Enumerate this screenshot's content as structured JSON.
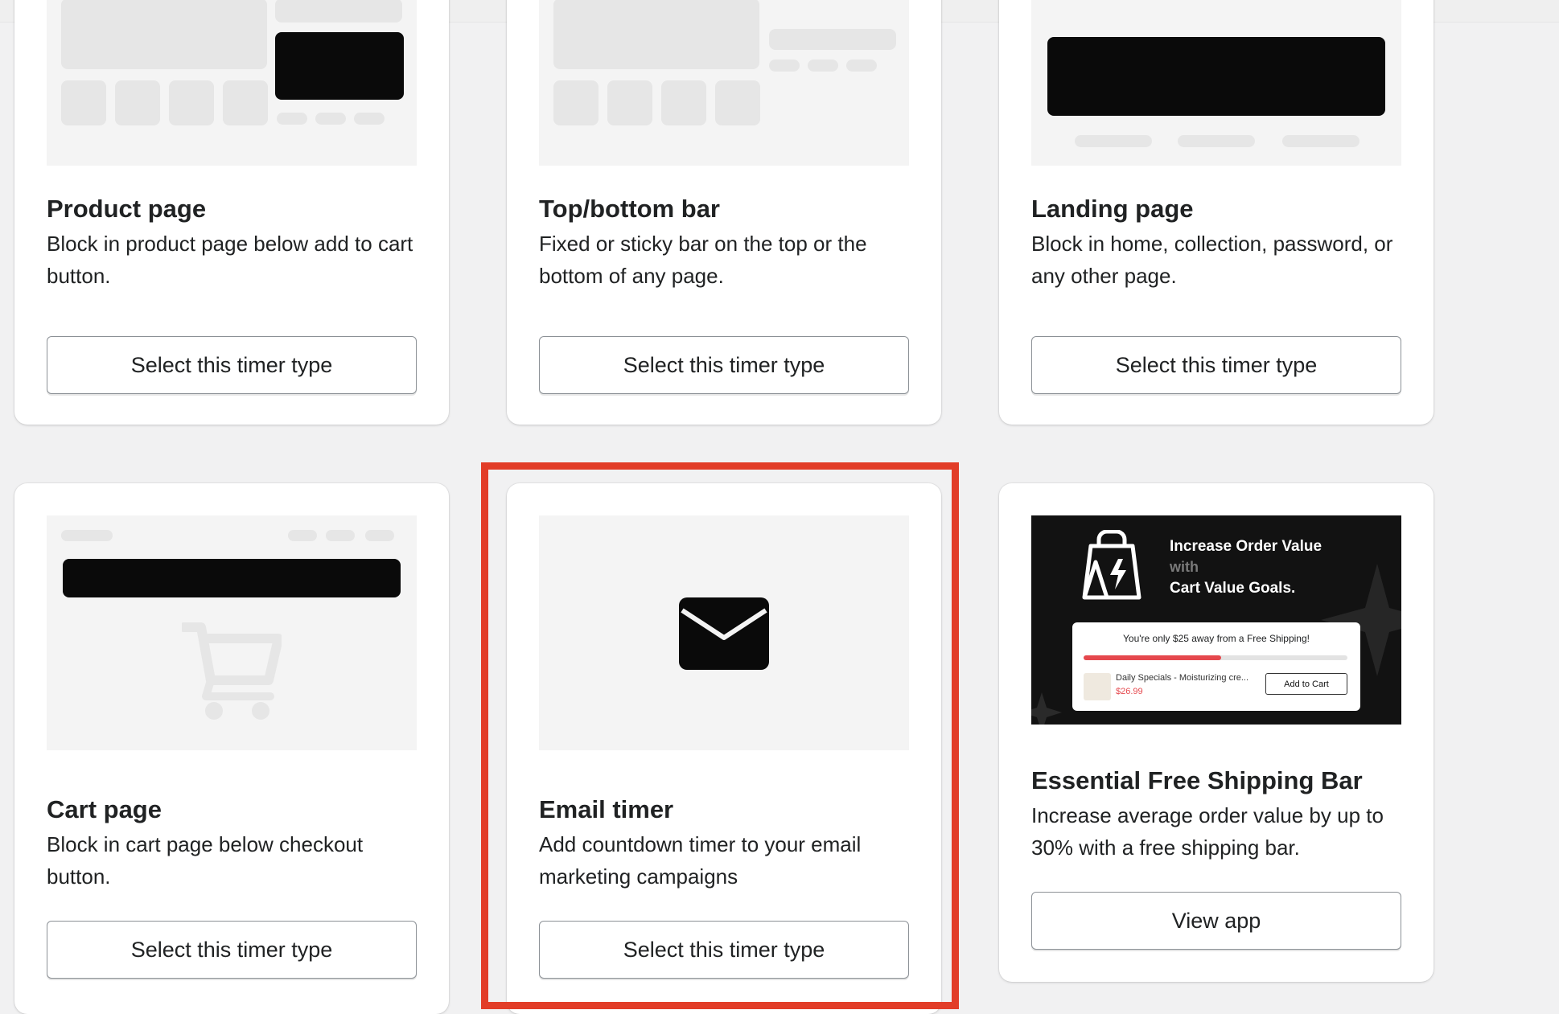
{
  "cards": [
    {
      "title": "Product page",
      "description": "Block in product page below add to cart button.",
      "button": "Select this timer type"
    },
    {
      "title": "Top/bottom bar",
      "description": "Fixed or sticky bar on the top or the bottom of any page.",
      "button": "Select this timer type"
    },
    {
      "title": "Landing page",
      "description": "Block in home, collection, password, or any other page.",
      "button": "Select this timer type"
    },
    {
      "title": "Cart page",
      "description": "Block in cart page below checkout button.",
      "button": "Select this timer type"
    },
    {
      "title": "Email timer",
      "description": "Add countdown timer to your email marketing campaigns",
      "button": "Select this timer type",
      "icon": "mail-icon"
    },
    {
      "title": "Essential Free Shipping Bar",
      "description": "Increase average order value by up to 30% with a free shipping bar.",
      "button": "View app"
    }
  ],
  "promo": {
    "line1": "Increase Order Value",
    "line2": "with",
    "line3": "Cart Value Goals.",
    "message": "You're only $25 away from a Free Shipping!",
    "progress": 0.52,
    "product_name": "Daily Specials - Moisturizing cre...",
    "price": "$26.99",
    "add_to_cart": "Add to Cart",
    "icons": [
      "shopping-bag-lightning-icon"
    ]
  },
  "colors": {
    "highlight": "#e23d28",
    "accent_red": "#e5484d",
    "background": "#f1f1f2"
  }
}
